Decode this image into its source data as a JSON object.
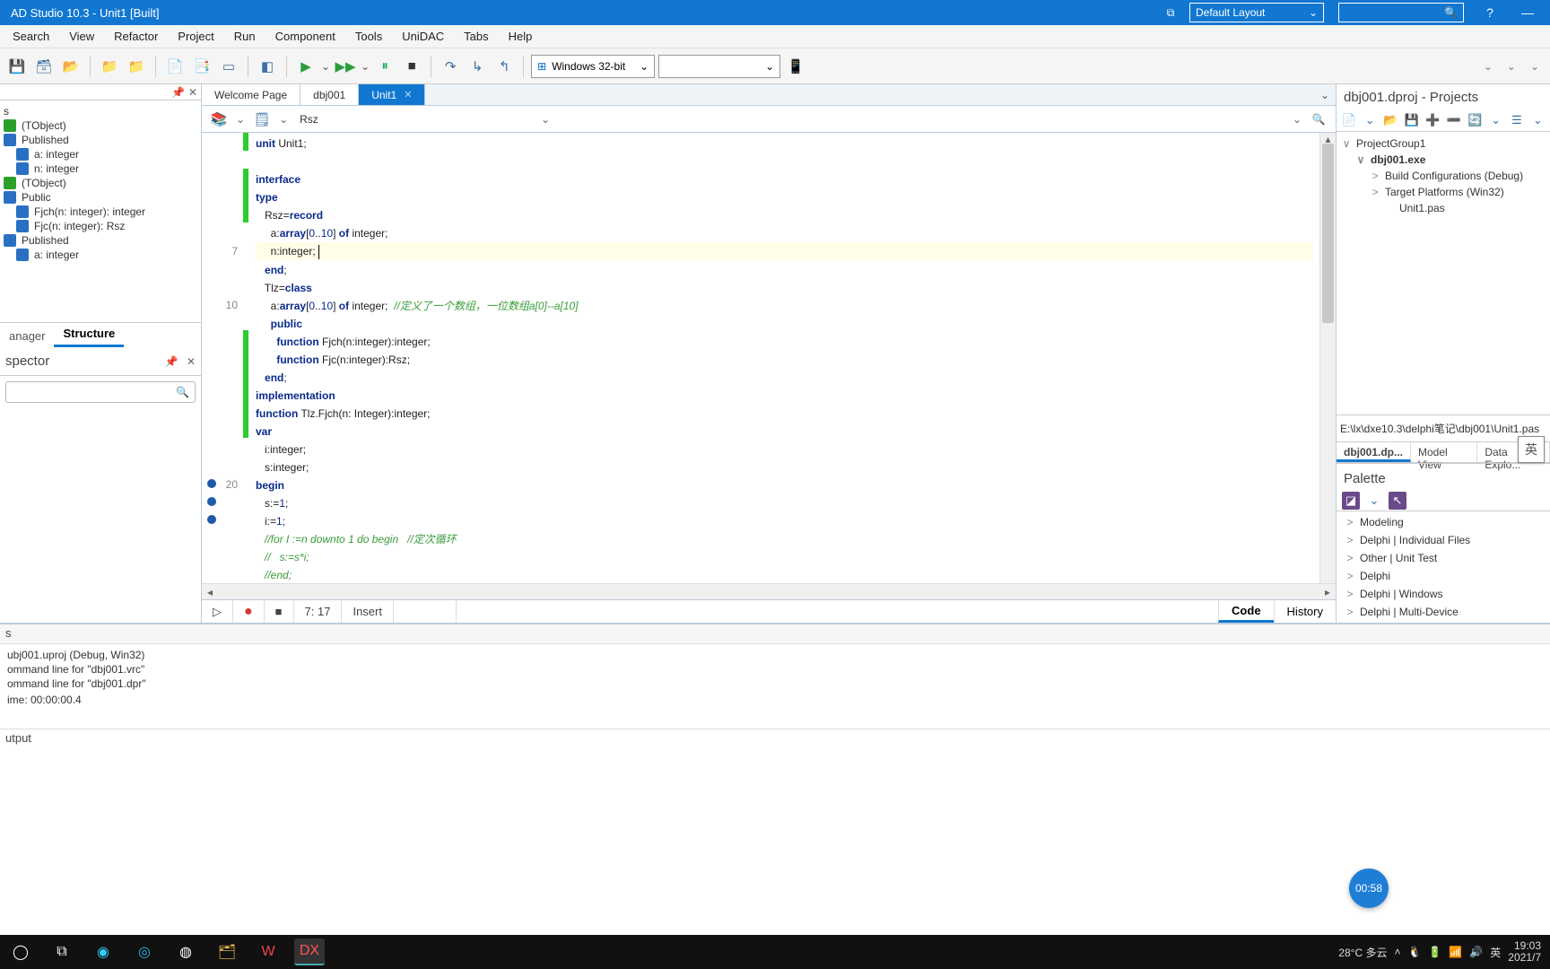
{
  "titlebar": {
    "title": "AD Studio 10.3 - Unit1 [Built]",
    "layout": "Default Layout",
    "help": "?",
    "min": "—"
  },
  "menu": [
    "Search",
    "View",
    "Refactor",
    "Project",
    "Run",
    "Component",
    "Tools",
    "UniDAC",
    "Tabs",
    "Help"
  ],
  "platform_combo": "Windows 32-bit",
  "left": {
    "items": [
      {
        "ico": "",
        "label": "s",
        "indent": 0
      },
      {
        "ico": "green",
        "label": "(TObject)",
        "indent": 0
      },
      {
        "ico": "blue",
        "label": "Published",
        "indent": 0
      },
      {
        "ico": "blue",
        "label": "a: integer",
        "indent": 1
      },
      {
        "ico": "blue",
        "label": "n: integer",
        "indent": 1
      },
      {
        "ico": "green",
        "label": "(TObject)",
        "indent": 0
      },
      {
        "ico": "blue",
        "label": "Public",
        "indent": 0
      },
      {
        "ico": "blue",
        "label": "Fjch(n: integer): integer",
        "indent": 1
      },
      {
        "ico": "blue",
        "label": "Fjc(n: integer): Rsz",
        "indent": 1
      },
      {
        "ico": "blue",
        "label": "Published",
        "indent": 0
      },
      {
        "ico": "blue",
        "label": "a: integer",
        "indent": 1
      }
    ],
    "tabs": {
      "t1": "anager",
      "t2": "Structure"
    },
    "inspector_title": "spector"
  },
  "file_tabs": [
    {
      "label": "Welcome Page",
      "active": false,
      "closeable": false
    },
    {
      "label": "dbj001",
      "active": false,
      "closeable": false
    },
    {
      "label": "Unit1",
      "active": true,
      "closeable": true
    }
  ],
  "nav_symbol": "Rsz",
  "code_lines": [
    {
      "n": "",
      "g": true,
      "html": "<span class='kw'>unit</span> Unit1;"
    },
    {
      "n": "",
      "g": false,
      "html": ""
    },
    {
      "n": "",
      "g": true,
      "html": "<span class='kw'>interface</span>"
    },
    {
      "n": "",
      "g": true,
      "html": "<span class='kw'>type</span>"
    },
    {
      "n": "",
      "g": true,
      "html": "   Rsz=<span class='ty'>record</span>"
    },
    {
      "n": "",
      "g": false,
      "html": "     a:<span class='ty'>array</span>[<span class='num'>0</span>..<span class='num'>10</span>] <span class='kw'>of</span> integer;"
    },
    {
      "n": "7",
      "g": false,
      "hl": true,
      "html": "     n:integer; <span class='cursor'></span>"
    },
    {
      "n": "",
      "g": false,
      "html": "   <span class='kw'>end</span>;"
    },
    {
      "n": "",
      "g": false,
      "html": "   Tlz=<span class='ty'>class</span>"
    },
    {
      "n": "10",
      "g": false,
      "html": "     a:<span class='ty'>array</span>[<span class='num'>0</span>..<span class='num'>10</span>] <span class='kw'>of</span> integer;  <span class='cm'>//定义了一个数组，一位数组a[0]--a[10]</span>"
    },
    {
      "n": "",
      "g": false,
      "html": "     <span class='kw'>public</span>"
    },
    {
      "n": "",
      "g": true,
      "html": "       <span class='kw'>function</span> Fjch(n:integer):integer;"
    },
    {
      "n": "",
      "g": true,
      "html": "       <span class='kw'>function</span> Fjc(n:integer):Rsz;"
    },
    {
      "n": "",
      "g": true,
      "html": "   <span class='kw'>end</span>;"
    },
    {
      "n": "",
      "g": true,
      "html": "<span class='kw'>implementation</span>"
    },
    {
      "n": "",
      "g": true,
      "html": "<span class='kw'>function</span> Tlz.Fjch(n: Integer):integer;"
    },
    {
      "n": "",
      "g": true,
      "html": "<span class='kw'>var</span>"
    },
    {
      "n": "",
      "g": false,
      "html": "   i:integer;"
    },
    {
      "n": "",
      "g": false,
      "html": "   s:integer;"
    },
    {
      "n": "20",
      "g": false,
      "bp": true,
      "html": "<span class='kw'>begin</span>"
    },
    {
      "n": "",
      "g": false,
      "bp": true,
      "html": "   s:=<span class='num'>1</span>;"
    },
    {
      "n": "",
      "g": false,
      "bp": true,
      "html": "   i:=<span class='num'>1</span>;"
    },
    {
      "n": "",
      "g": false,
      "html": "   <span class='cm'>//for I :=n downto 1 do begin   //定次循环</span>"
    },
    {
      "n": "",
      "g": false,
      "html": "   <span class='cm'>//   s:=s*i;</span>"
    },
    {
      "n": "",
      "g": false,
      "html": "   <span class='cm'>//end;</span>"
    }
  ],
  "status": {
    "pos": "7: 17",
    "mode": "Insert",
    "code_tab": "Code",
    "history_tab": "History"
  },
  "right": {
    "panel_title": "dbj001.dproj - Projects",
    "tree": [
      {
        "indent": 0,
        "chev": "∨",
        "label": "ProjectGroup1",
        "bold": false
      },
      {
        "indent": 1,
        "chev": "∨",
        "label": "dbj001.exe",
        "bold": true
      },
      {
        "indent": 2,
        "chev": ">",
        "label": "Build Configurations (Debug)",
        "bold": false
      },
      {
        "indent": 2,
        "chev": ">",
        "label": "Target Platforms (Win32)",
        "bold": false
      },
      {
        "indent": 3,
        "chev": "",
        "label": "Unit1.pas",
        "bold": false
      }
    ],
    "path": "E:\\lx\\dxe10.3\\delphi笔记\\dbj001\\Unit1.pas",
    "tabs": [
      {
        "label": "dbj001.dp...",
        "active": true
      },
      {
        "label": "Model View",
        "active": false
      },
      {
        "label": "Data Explo...",
        "active": false
      }
    ],
    "palette_title": "Palette",
    "palette": [
      "Modeling",
      "Delphi | Individual Files",
      "Other | Unit Test",
      "Delphi",
      "Delphi | Windows",
      "Delphi | Multi-Device"
    ]
  },
  "messages": {
    "head": "s",
    "lines": [
      "ubj001.uproj (Debug, Win32)",
      "ommand line for \"dbj001.vrc\"",
      "ommand line for \"dbj001.dpr\"",
      "",
      "ime: 00:00:00.4"
    ],
    "output_tab": "utput"
  },
  "video_timer": "00:58",
  "taskbar": {
    "weather": "28°C 多云",
    "time": "19:03",
    "date": "2021/7"
  },
  "ime": "英"
}
